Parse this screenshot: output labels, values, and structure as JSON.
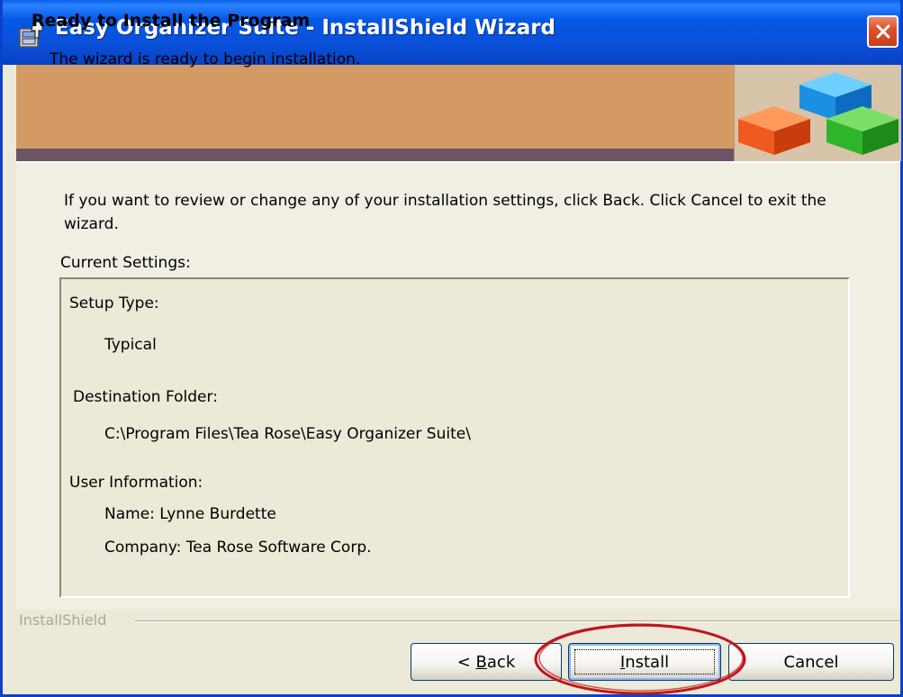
{
  "window": {
    "title": "Easy Organizer Suite - InstallShield Wizard"
  },
  "header": {
    "title": "Ready to Install the Program",
    "subtitle": "The wizard is ready to begin installation."
  },
  "body": {
    "intro": "If you want to review or change any of your installation settings, click Back. Click Cancel to exit the wizard.",
    "settings_label": "Current Settings:",
    "settings": {
      "setup_type_label": "Setup Type:",
      "setup_type_value": "Typical",
      "destination_label": "Destination Folder:",
      "destination_value": "C:\\Program Files\\Tea Rose\\Easy Organizer Suite\\",
      "user_info_label": "User Information:",
      "name_line": "Name: Lynne Burdette",
      "company_line": "Company: Tea Rose Software Corp."
    }
  },
  "footer": {
    "brand": "InstallShield"
  },
  "buttons": {
    "back_prefix": "< ",
    "back_mnemonic": "B",
    "back_rest": "ack",
    "install_mnemonic": "I",
    "install_rest": "nstall",
    "cancel": "Cancel"
  },
  "icons": {
    "app": "installer-icon",
    "close": "close-icon",
    "logo": "colored-blocks-logo"
  },
  "colors": {
    "titlebar": "#0558e6",
    "header_band": "#d49a64",
    "header_stripe": "#6b5464",
    "close_button": "#d9532d",
    "highlight_annotation": "#c0151d"
  }
}
